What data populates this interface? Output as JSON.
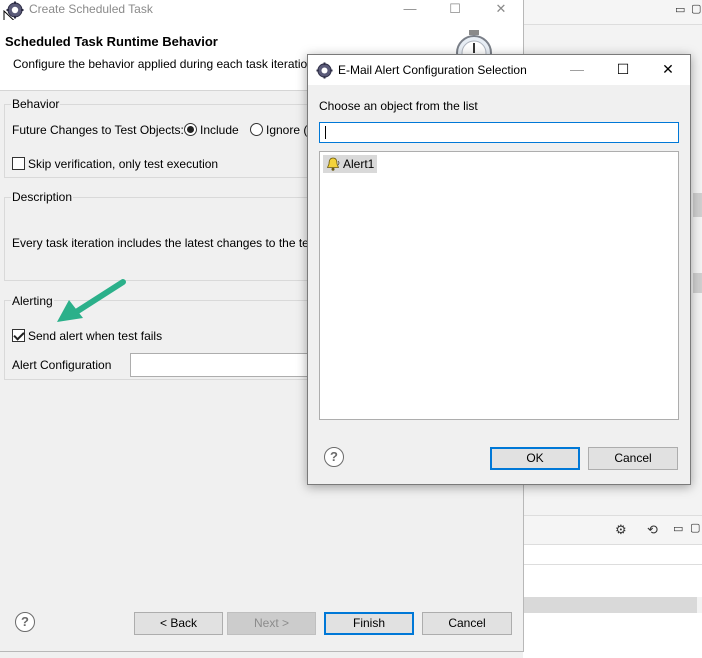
{
  "wizard": {
    "title": "Create Scheduled Task",
    "heading": "Scheduled Task Runtime Behavior",
    "subheading": "Configure the behavior applied during each task iteratio",
    "behavior": {
      "group_label": "Behavior",
      "future_changes_label": "Future Changes to Test Objects:",
      "include_label": "Include",
      "ignore_label": "Ignore (",
      "skip_verification_label": "Skip verification, only test execution",
      "include_selected": true,
      "skip_verification_checked": false
    },
    "description": {
      "group_label": "Description",
      "text": "Every task iteration includes the latest changes to the tes"
    },
    "alerting": {
      "group_label": "Alerting",
      "send_alert_label": "Send alert when test fails",
      "send_alert_checked": true,
      "alert_config_label": "Alert Configuration",
      "alert_config_value": ""
    },
    "buttons": {
      "back": "< Back",
      "next": "Next >",
      "finish": "Finish",
      "cancel": "Cancel"
    }
  },
  "dialog": {
    "title": "E-Mail Alert Configuration Selection",
    "prompt": "Choose an object from the list",
    "filter_value": "",
    "items": [
      "Alert1"
    ],
    "buttons": {
      "ok": "OK",
      "cancel": "Cancel"
    }
  },
  "colors": {
    "accent": "#0078d7",
    "arrow": "#2bb08a"
  },
  "icons": {
    "app": "eclipse-gear-icon",
    "alert": "bell-alert-icon",
    "help": "question-mark-icon"
  }
}
